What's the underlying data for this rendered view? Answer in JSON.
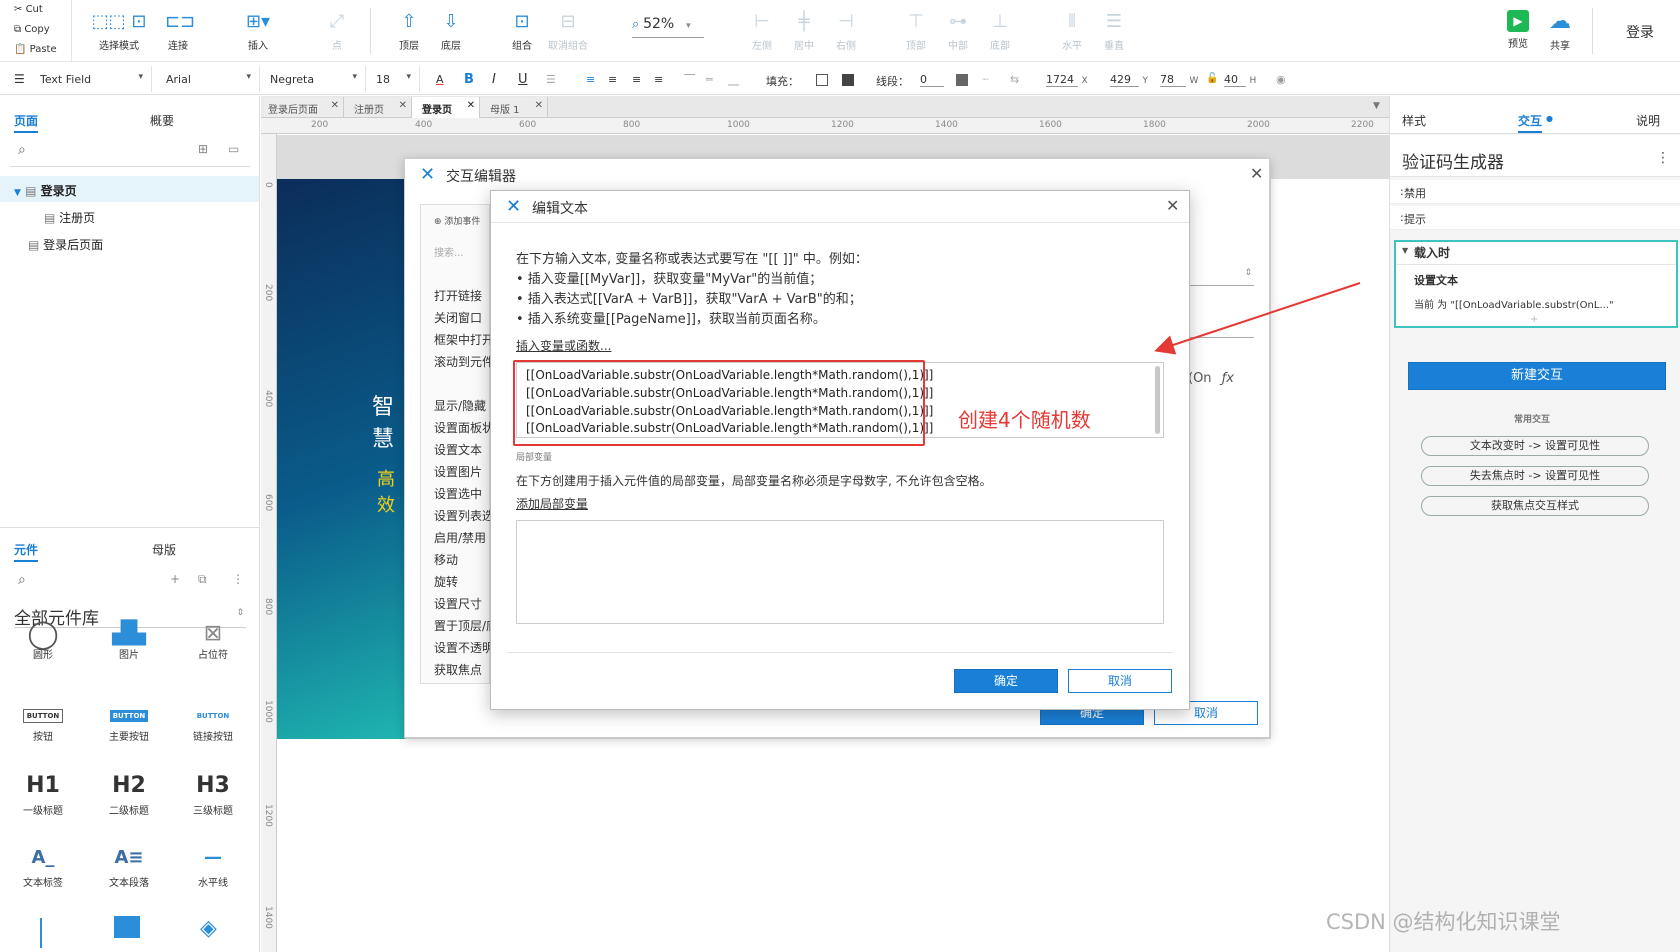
{
  "toolbar": {
    "clipboard": {
      "cut": "Cut",
      "copy": "Copy",
      "paste": "Paste"
    },
    "buttons": [
      {
        "label": "选择模式"
      },
      {
        "label": "连接"
      },
      {
        "label": "插入"
      },
      {
        "label": "点"
      },
      {
        "label": "顶层"
      },
      {
        "label": "底层"
      },
      {
        "label": "组合"
      },
      {
        "label": "取消组合"
      },
      {
        "label": "左侧"
      },
      {
        "label": "居中"
      },
      {
        "label": "右侧"
      },
      {
        "label": "顶部"
      },
      {
        "label": "中部"
      },
      {
        "label": "底部"
      },
      {
        "label": "水平"
      },
      {
        "label": "垂直"
      },
      {
        "label": "预览"
      },
      {
        "label": "共享"
      }
    ],
    "zoom": "52%",
    "login": "登录"
  },
  "format": {
    "widget_type": "Text Field",
    "font": "Arial",
    "style": "Negreta",
    "size": "18",
    "fill_label": "填充：",
    "line_label": "线段：",
    "line_value": "0",
    "x": "1724",
    "x_unit": "X",
    "y": "429",
    "y_unit": "Y",
    "w": "78",
    "w_unit": "W",
    "h": "40",
    "h_unit": "H"
  },
  "left": {
    "tabs": [
      "页面",
      "概要"
    ],
    "pages": [
      "登录页",
      "注册页",
      "登录后页面"
    ],
    "lib_tabs": [
      "元件",
      "母版"
    ],
    "lib_title": "全部元件库",
    "widgets": [
      {
        "label": "圆形",
        "icon": "circle-icon"
      },
      {
        "label": "图片",
        "icon": "image-icon"
      },
      {
        "label": "占位符",
        "icon": "placeholder-icon"
      },
      {
        "label": "按钮",
        "icon": "button-icon",
        "glyph": "BUTTON"
      },
      {
        "label": "主要按钮",
        "icon": "primary-button-icon",
        "glyph": "BUTTON"
      },
      {
        "label": "链接按钮",
        "icon": "link-button-icon",
        "glyph": "BUTTON"
      },
      {
        "label": "一级标题",
        "icon": "h1-icon",
        "glyph": "H1"
      },
      {
        "label": "二级标题",
        "icon": "h2-icon",
        "glyph": "H2"
      },
      {
        "label": "三级标题",
        "icon": "h3-icon",
        "glyph": "H3"
      },
      {
        "label": "文本标签",
        "icon": "text-label-icon",
        "glyph": "A_"
      },
      {
        "label": "文本段落",
        "icon": "paragraph-icon",
        "glyph": "A≡"
      },
      {
        "label": "水平线",
        "icon": "horizontal-line-icon",
        "glyph": "—"
      }
    ]
  },
  "tabs": [
    "登录后页面",
    "注册页",
    "登录页",
    "母版 1"
  ],
  "ruler_h": [
    "200",
    "400",
    "600",
    "800",
    "1000",
    "1200",
    "1400",
    "1600",
    "1800",
    "2000",
    "2200"
  ],
  "ruler_v": [
    "0",
    "200",
    "400",
    "600",
    "800",
    "1000",
    "1200",
    "1400"
  ],
  "canvas": {
    "text1": "智慧",
    "text2": "高效"
  },
  "interaction_editor": {
    "title": "交互编辑器",
    "add_event": "添加事件",
    "search": "搜索...",
    "actions": [
      "打开链接",
      "关闭窗口",
      "框架中打开",
      "滚动到元件",
      "显示/隐藏",
      "设置面板状态",
      "设置文本",
      "设置图片",
      "设置选中",
      "设置列表选中项",
      "启用/禁用",
      "移动",
      "旋转",
      "设置尺寸",
      "置于顶层/底层",
      "设置不透明",
      "获取焦点"
    ],
    "ok": "确定",
    "cancel": "取消",
    "partial": "(On"
  },
  "edit_text": {
    "title": "编辑文本",
    "intro": "在下方输入文本, 变量名称或表达式要写在 \"[[ ]]\" 中。例如：",
    "ex1": "• 插入变量[[MyVar]]，获取变量\"MyVar\"的当前值；",
    "ex2": "• 插入表达式[[VarA + VarB]]，获取\"VarA + VarB\"的和；",
    "ex3": "• 插入系统变量[[PageName]]，获取当前页面名称。",
    "insert_link": "插入变量或函数...",
    "lines": [
      "[[OnLoadVariable.substr(OnLoadVariable.length*Math.random(),1)]]",
      "[[OnLoadVariable.substr(OnLoadVariable.length*Math.random(),1)]]",
      "[[OnLoadVariable.substr(OnLoadVariable.length*Math.random(),1)]]",
      "[[OnLoadVariable.substr(OnLoadVariable.length*Math.random(),1)]]"
    ],
    "local_var_title": "局部变量",
    "local_var_desc": "在下方创建用于插入元件值的局部变量，局部变量名称必须是字母数字, 不允许包含空格。",
    "add_local": "添加局部变量",
    "ok": "确定",
    "cancel": "取消"
  },
  "annotation": {
    "text": "创建4个随机数",
    "color": "#e53935"
  },
  "right": {
    "tabs": [
      "样式",
      "交互",
      "说明"
    ],
    "widget_name": "验证码生成器",
    "disabled": "禁用",
    "hint": "提示",
    "event": "载入时",
    "action": "设置文本",
    "action_detail": "当前 为 \"[[OnLoadVariable.substr(OnL...\"",
    "new_interaction": "新建交互",
    "common_title": "常用交互",
    "common": [
      "文本改变时 -> 设置可见性",
      "失去焦点时 -> 设置可见性",
      "获取焦点交互样式"
    ]
  },
  "watermark": "CSDN @结构化知识课堂",
  "colors": {
    "accent": "#1a7fd6",
    "teal": "#1fb5b0",
    "highlight": "#e53935"
  }
}
